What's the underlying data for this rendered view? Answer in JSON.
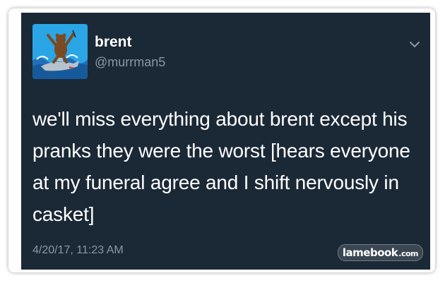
{
  "tweet": {
    "display_name": "brent",
    "handle": "@murrman5",
    "text": "we'll miss everything about brent except his pranks they were the worst [hears everyone at my funeral agree and I shift nervously in casket]",
    "timestamp": "4/20/17, 11:23 AM"
  },
  "watermark": {
    "brand": "lamebook",
    "domain": ".com"
  },
  "icons": {
    "avatar": "avatar-bear-riding-shark",
    "menu": "chevron-down-icon"
  },
  "colors": {
    "card_background": "#1b2836",
    "primary_text": "#ffffff",
    "secondary_text": "#8899a6"
  }
}
